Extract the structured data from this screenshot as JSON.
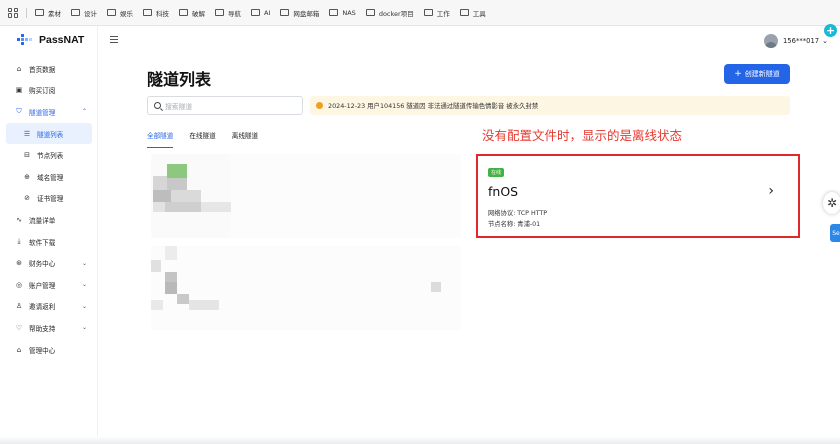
{
  "bookmarks": [
    "素材",
    "设计",
    "娱乐",
    "科技",
    "破解",
    "导航",
    "AI",
    "网盘邮箱",
    "NAS",
    "docker项目",
    "工作",
    "工具"
  ],
  "brand": {
    "name": "PassNAT"
  },
  "user": {
    "name": "156***017"
  },
  "sidebar": {
    "items": [
      {
        "label": "首页数据",
        "icon": "home-icon"
      },
      {
        "label": "购买订阅",
        "icon": "cart-icon"
      },
      {
        "label": "隧道管理",
        "icon": "shield-icon"
      },
      {
        "label": "隧道列表",
        "icon": "list-icon"
      },
      {
        "label": "节点列表",
        "icon": "server-icon"
      },
      {
        "label": "域名管理",
        "icon": "globe-icon"
      },
      {
        "label": "证书管理",
        "icon": "certificate-icon"
      },
      {
        "label": "流量详单",
        "icon": "activity-icon"
      },
      {
        "label": "软件下载",
        "icon": "download-icon"
      },
      {
        "label": "财务中心",
        "icon": "finance-icon"
      },
      {
        "label": "账户管理",
        "icon": "account-icon"
      },
      {
        "label": "邀请返利",
        "icon": "invite-icon"
      },
      {
        "label": "帮助支持",
        "icon": "help-icon"
      },
      {
        "label": "管理中心",
        "icon": "admin-icon"
      }
    ]
  },
  "main": {
    "title": "隧道列表",
    "create_button": "创建新隧道",
    "search_placeholder": "搜索隧道",
    "notice": "2024-12-23 用户104156 隧道因 非法通过隧道传输色情影音 被永久封禁",
    "tabs": [
      "全部隧道",
      "在线隧道",
      "离线隧道"
    ],
    "annotation": "没有配置文件时，显示的是离线状态"
  },
  "card": {
    "status": "在线",
    "name": "fnOS",
    "protocol_label": "网络协议: TCP HTTP",
    "node_label": "节点名称: 青浦-01"
  },
  "floating": {
    "side_label": "Se"
  },
  "colors": {
    "primary": "#2465e8",
    "online_badge": "#43b244",
    "annotation_red": "#e8382f",
    "notice_bg": "#fdf6e3"
  }
}
